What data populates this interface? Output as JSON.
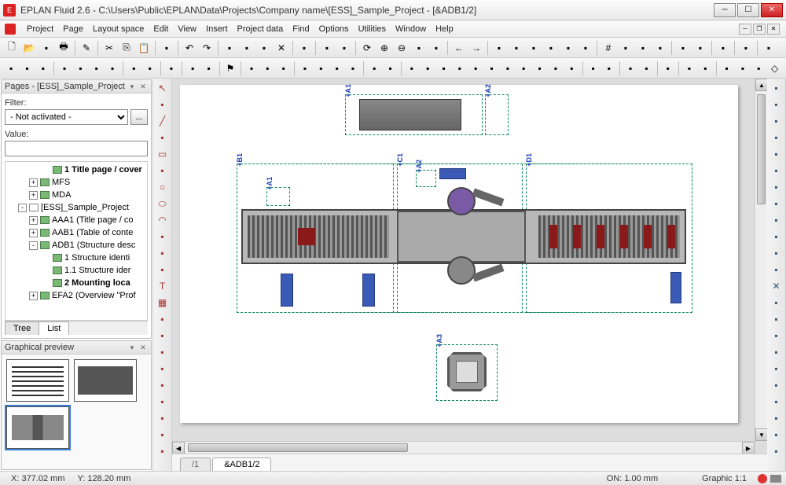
{
  "window": {
    "title": "EPLAN Fluid 2.6 - C:\\Users\\Public\\EPLAN\\Data\\Projects\\Company name\\[ESS]_Sample_Project - [&ADB1/2]",
    "app_icon_text": "E"
  },
  "menu": {
    "items": [
      "Project",
      "Page",
      "Layout space",
      "Edit",
      "View",
      "Insert",
      "Project data",
      "Find",
      "Options",
      "Utilities",
      "Window",
      "Help"
    ]
  },
  "pages_panel": {
    "title": "Pages - [ESS]_Sample_Project",
    "filter_label": "Filter:",
    "filter_value": "- Not activated -",
    "filter_button": "...",
    "value_label": "Value:",
    "value_input": "",
    "tree": [
      {
        "indent": 3,
        "exp": "",
        "icon": "page",
        "text": "1 Title page / cover",
        "bold": true
      },
      {
        "indent": 2,
        "exp": "+",
        "icon": "struct",
        "text": "MFS",
        "bold": false
      },
      {
        "indent": 2,
        "exp": "+",
        "icon": "struct",
        "text": "MDA",
        "bold": false
      },
      {
        "indent": 1,
        "exp": "-",
        "icon": "proj",
        "text": "[ESS]_Sample_Project",
        "bold": false
      },
      {
        "indent": 2,
        "exp": "+",
        "icon": "struct",
        "text": "AAA1 (Title page / co",
        "bold": false
      },
      {
        "indent": 2,
        "exp": "+",
        "icon": "struct",
        "text": "AAB1 (Table of conte",
        "bold": false
      },
      {
        "indent": 2,
        "exp": "-",
        "icon": "struct",
        "text": "ADB1 (Structure desc",
        "bold": false
      },
      {
        "indent": 3,
        "exp": "",
        "icon": "page",
        "text": "1 Structure identi",
        "bold": false
      },
      {
        "indent": 3,
        "exp": "",
        "icon": "page",
        "text": "1.1 Structure ider",
        "bold": false
      },
      {
        "indent": 3,
        "exp": "",
        "icon": "page",
        "text": "2 Mounting loca",
        "bold": true
      },
      {
        "indent": 2,
        "exp": "+",
        "icon": "struct",
        "text": "EFA2 (Overview \"Prof",
        "bold": false
      }
    ],
    "tabs": [
      "Tree",
      "List"
    ],
    "active_tab": "List"
  },
  "preview_panel": {
    "title": "Graphical preview"
  },
  "canvas": {
    "zones": {
      "A1_top": "+A1",
      "A2_top": "+A2",
      "B1": "+B1",
      "A1_mid": "+A1",
      "C1": "+C1",
      "A2_mid": "+A2",
      "D1": "+D1",
      "A3": "+A3"
    },
    "page_tabs": [
      "/1",
      "&ADB1/2"
    ],
    "active_page_tab": "&ADB1/2"
  },
  "status": {
    "x_label": "X: 377.02 mm",
    "y_label": "Y: 128.20 mm",
    "on_label": "ON: 1.00 mm",
    "graphic_label": "Graphic 1:1"
  },
  "toolbar_icons_row1": [
    "new",
    "open",
    "copy-proj",
    "print",
    "sep",
    "wand",
    "sep",
    "cut",
    "copy",
    "paste",
    "sep",
    "redbox",
    "sep",
    "undo",
    "redo",
    "sep",
    "measure",
    "tag",
    "tag2",
    "cross",
    "sep",
    "maximize",
    "sep",
    "window",
    "window2",
    "sep",
    "refresh",
    "zoom-in",
    "zoom-out",
    "zoom-fit",
    "zoom-sel",
    "sep",
    "back",
    "fwd",
    "sep",
    "grid1",
    "grid2",
    "grid3",
    "grid4",
    "grid5",
    "grid6",
    "sep",
    "snap",
    "ortho",
    "endpoint",
    "midpoint",
    "sep",
    "layer1",
    "layer2",
    "sep",
    "view3d",
    "sep",
    "tree-btn",
    "sep",
    "export"
  ],
  "toolbar_icons_row2": [
    "nav1",
    "nav2",
    "green-go",
    "sep",
    "a",
    "b",
    "c",
    "d",
    "sep",
    "flag-green",
    "flag-red",
    "sep",
    "rect-tool",
    "sep",
    "play-green",
    "play-blue",
    "sep",
    "flag2",
    "sep",
    "doc1",
    "doc2",
    "doc3",
    "sep",
    "layout1",
    "layout2",
    "layout3",
    "layout4",
    "sep",
    "grid-a",
    "grid-b",
    "sep",
    "comp1",
    "comp2",
    "comp3",
    "comp4",
    "comp5",
    "comp6",
    "comp7",
    "comp8",
    "comp9",
    "comp10",
    "comp11",
    "sep",
    "color1",
    "color2",
    "sep",
    "align1",
    "align2",
    "sep",
    "pink1",
    "sep",
    "conn1",
    "conn2",
    "sep",
    "red1",
    "red2",
    "red3",
    "diamond"
  ],
  "left_vtool_icons": [
    "cursor",
    "poly-cursor",
    "line",
    "polyline",
    "rect",
    "rect-round",
    "circle",
    "ellipse",
    "arc",
    "pie",
    "curve",
    "spline",
    "text",
    "image",
    "dim-h",
    "dim-v",
    "dim-ang",
    "dim-rad",
    "dim-inc",
    "dim-rad2",
    "arrow1",
    "arrow2",
    "arrow3"
  ],
  "right_vtool_icons": [
    "port-l",
    "port-r",
    "port-u",
    "port-d",
    "corner-tl",
    "corner-tr",
    "corner-bl",
    "corner-br",
    "tee-l",
    "tee-r",
    "tee-u",
    "tee-d",
    "cross",
    "jump-l",
    "jump-r",
    "jump-u",
    "jump-d",
    "node",
    "break-l",
    "break-r",
    "bus-h",
    "bus-v",
    "term"
  ]
}
